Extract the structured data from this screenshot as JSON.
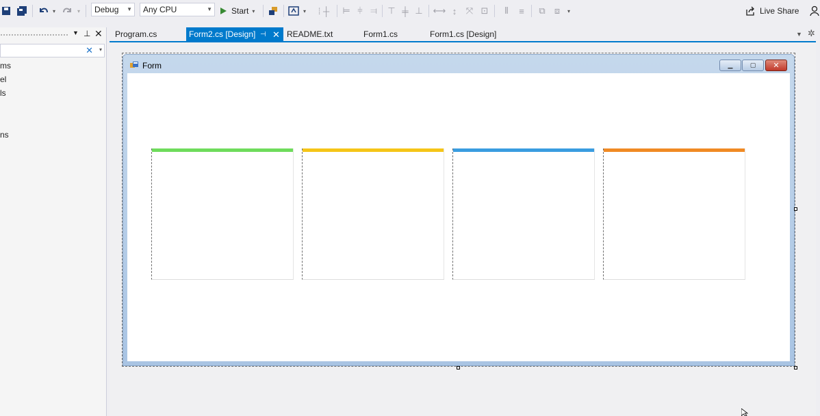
{
  "toolbar": {
    "config": "Debug",
    "platform": "Any CPU",
    "start_label": "Start",
    "live_share": "Live Share"
  },
  "left_panel": {
    "items": [
      "ms",
      "el",
      "ls",
      "ns"
    ]
  },
  "tabs": [
    {
      "label": "Program.cs"
    },
    {
      "label": "Form2.cs [Design]"
    },
    {
      "label": "README.txt"
    },
    {
      "label": "Form1.cs"
    },
    {
      "label": "Form1.cs [Design]"
    }
  ],
  "form": {
    "title": "Form",
    "cards": [
      {
        "accent": "#6fdc5c"
      },
      {
        "accent": "#f5c518"
      },
      {
        "accent": "#3a9de0"
      },
      {
        "accent": "#f08a24"
      }
    ]
  },
  "colors": {
    "accent": "#007acc"
  }
}
